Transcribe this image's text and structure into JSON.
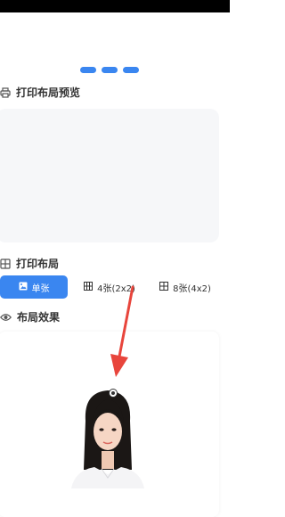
{
  "status_bar": {
    "color": "#000000"
  },
  "pager": {
    "count": 3,
    "accent": "#3a86f0"
  },
  "sections": {
    "preview": {
      "title": "打印布局预览",
      "icon": "printer-icon"
    },
    "layout": {
      "title": "打印布局",
      "icon": "grid-icon"
    },
    "effect": {
      "title": "布局效果",
      "icon": "eye-icon"
    }
  },
  "layout_tabs": [
    {
      "label": "单张",
      "icon": "image-icon",
      "active": true
    },
    {
      "label": "4张(2x2)",
      "icon": "grid-4-icon",
      "active": false
    },
    {
      "label": "8张(4x2)",
      "icon": "grid-8-icon",
      "active": false
    }
  ],
  "colors": {
    "accent": "#3a86f0",
    "panel_bg": "#f6f7f9",
    "arrow": "#e8453c"
  }
}
